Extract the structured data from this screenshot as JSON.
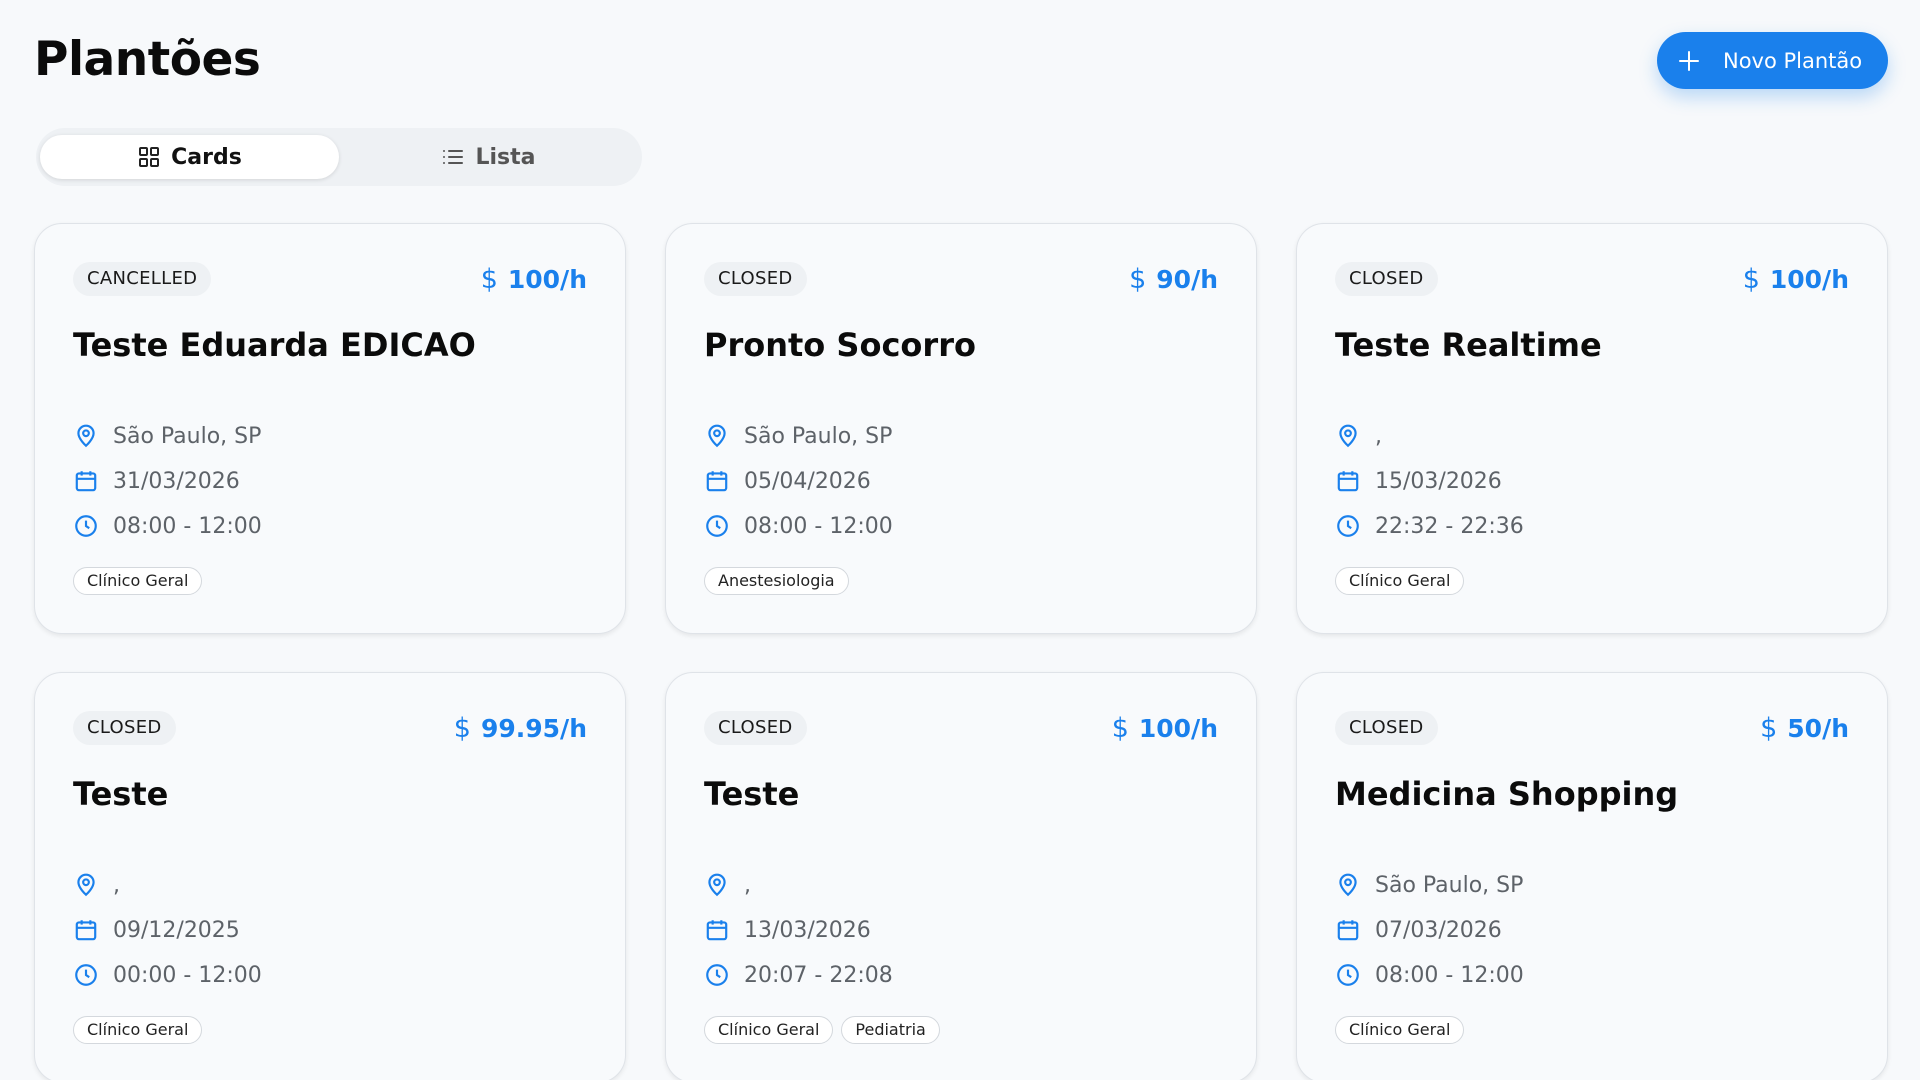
{
  "header": {
    "title": "Plantões",
    "new_button_label": "Novo Plantão"
  },
  "view_toggle": {
    "options": [
      {
        "label": "Cards",
        "active": true
      },
      {
        "label": "Lista",
        "active": false
      }
    ]
  },
  "accent_color": "#1a80ec",
  "cards": [
    {
      "status": "CANCELLED",
      "price": "100/h",
      "title": "Teste Eduarda EDICAO",
      "location": "São Paulo, SP",
      "date": "31/03/2026",
      "time": "08:00 - 12:00",
      "tags": [
        "Clínico Geral"
      ]
    },
    {
      "status": "CLOSED",
      "price": "90/h",
      "title": "Pronto Socorro",
      "location": "São Paulo, SP",
      "date": "05/04/2026",
      "time": "08:00 - 12:00",
      "tags": [
        "Anestesiologia"
      ]
    },
    {
      "status": "CLOSED",
      "price": "100/h",
      "title": "Teste Realtime",
      "location": ",",
      "date": "15/03/2026",
      "time": "22:32 - 22:36",
      "tags": [
        "Clínico Geral"
      ]
    },
    {
      "status": "CLOSED",
      "price": "99.95/h",
      "title": "Teste",
      "location": ",",
      "date": "09/12/2025",
      "time": "00:00 - 12:00",
      "tags": [
        "Clínico Geral"
      ]
    },
    {
      "status": "CLOSED",
      "price": "100/h",
      "title": "Teste",
      "location": ",",
      "date": "13/03/2026",
      "time": "20:07 - 22:08",
      "tags": [
        "Clínico Geral",
        "Pediatria"
      ]
    },
    {
      "status": "CLOSED",
      "price": "50/h",
      "title": "Medicina Shopping",
      "location": "São Paulo, SP",
      "date": "07/03/2026",
      "time": "08:00 - 12:00",
      "tags": [
        "Clínico Geral"
      ]
    }
  ]
}
